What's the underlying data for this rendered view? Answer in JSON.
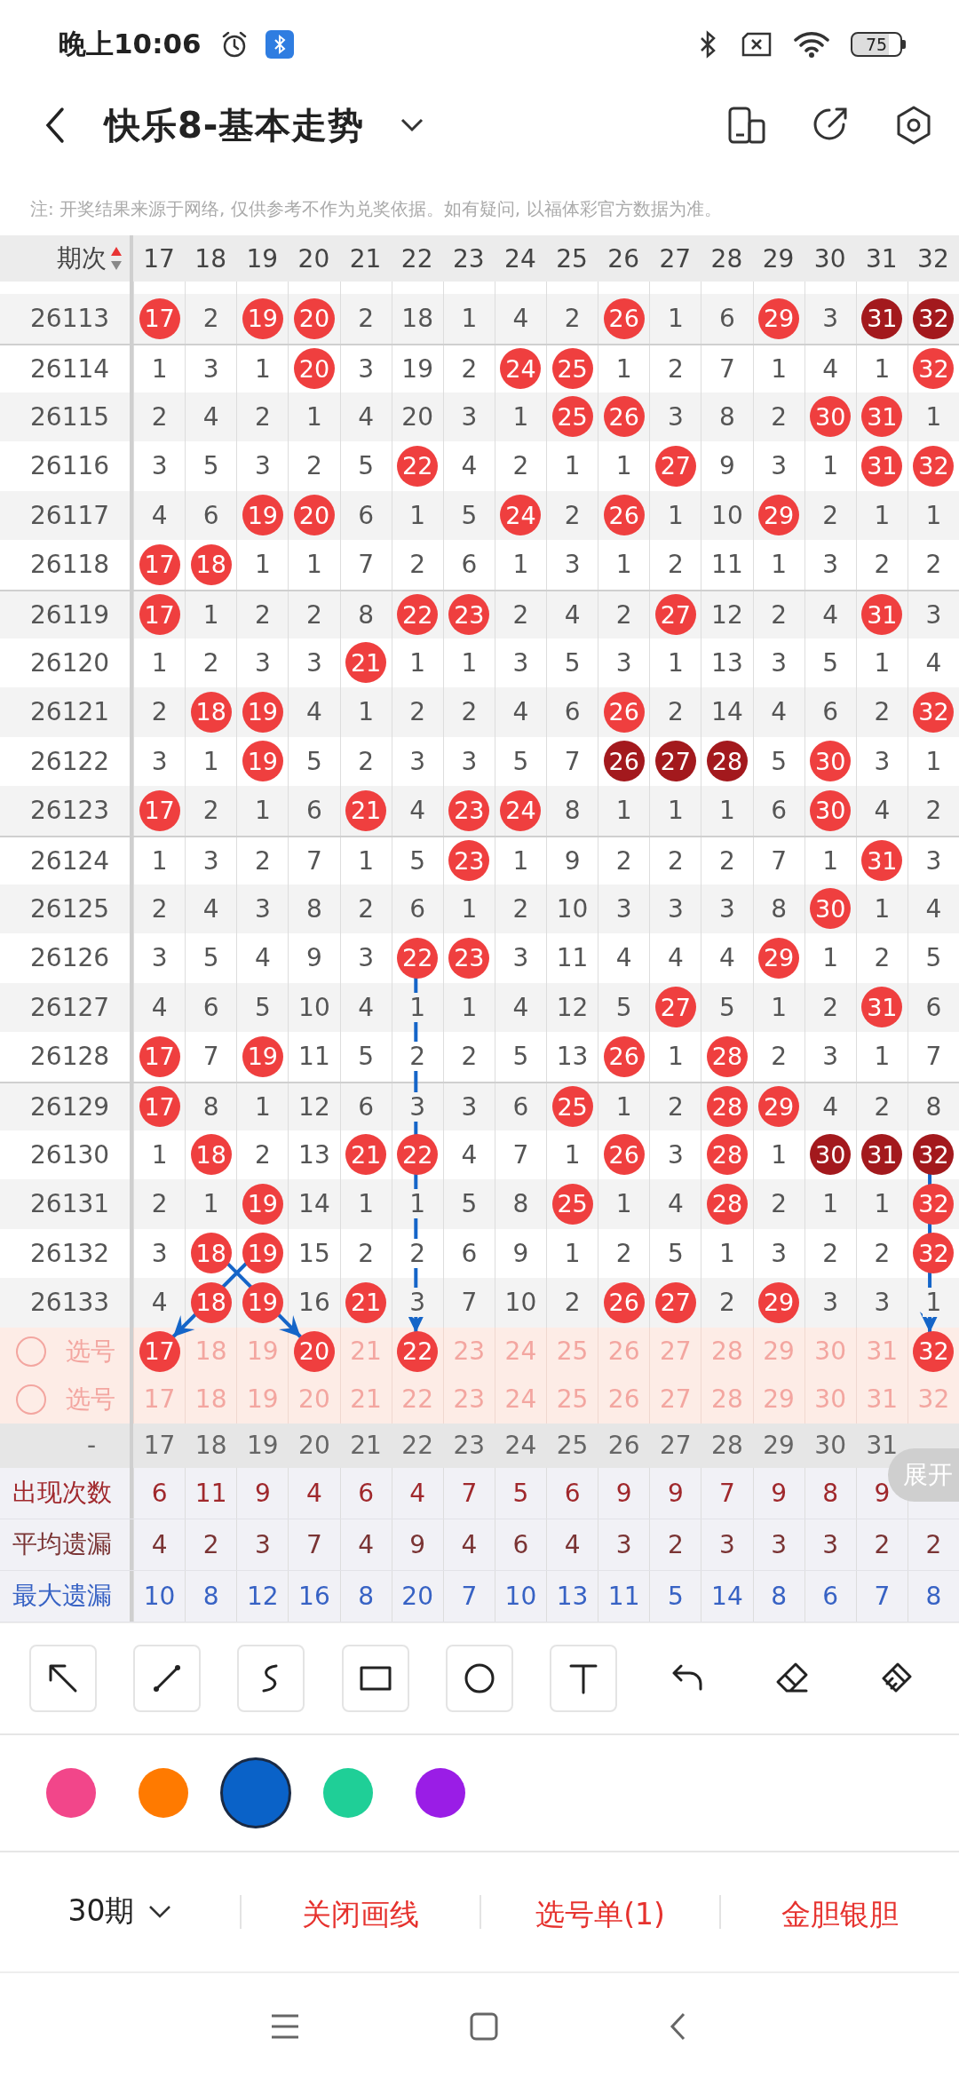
{
  "status_bar": {
    "time": "晚上10:06",
    "battery": "75"
  },
  "header": {
    "title": "快乐8-基本走势"
  },
  "notice": "注: 开奖结果来源于网络, 仅供参考不作为兑奖依据。如有疑问, 以福体彩官方数据为准。",
  "table": {
    "period_heading": "期次",
    "columns": [
      "17",
      "18",
      "19",
      "20",
      "21",
      "22",
      "23",
      "24",
      "25",
      "26",
      "27",
      "28",
      "29",
      "30",
      "31",
      "32"
    ],
    "rows": [
      {
        "period": "26113",
        "cells": [
          {
            "text": "17",
            "kind": "hit"
          },
          {
            "text": "2",
            "kind": "miss"
          },
          {
            "text": "19",
            "kind": "hit"
          },
          {
            "text": "20",
            "kind": "hit"
          },
          {
            "text": "2",
            "kind": "miss"
          },
          {
            "text": "18",
            "kind": "miss"
          },
          {
            "text": "1",
            "kind": "miss"
          },
          {
            "text": "4",
            "kind": "miss"
          },
          {
            "text": "2",
            "kind": "miss"
          },
          {
            "text": "26",
            "kind": "hit"
          },
          {
            "text": "1",
            "kind": "miss"
          },
          {
            "text": "6",
            "kind": "miss"
          },
          {
            "text": "29",
            "kind": "hit"
          },
          {
            "text": "3",
            "kind": "miss"
          },
          {
            "text": "31",
            "kind": "repeat"
          },
          {
            "text": "32",
            "kind": "repeat"
          }
        ]
      },
      {
        "period": "26114",
        "cells": [
          {
            "text": "1",
            "kind": "miss"
          },
          {
            "text": "3",
            "kind": "miss"
          },
          {
            "text": "1",
            "kind": "miss"
          },
          {
            "text": "20",
            "kind": "hit"
          },
          {
            "text": "3",
            "kind": "miss"
          },
          {
            "text": "19",
            "kind": "miss"
          },
          {
            "text": "2",
            "kind": "miss"
          },
          {
            "text": "24",
            "kind": "hit"
          },
          {
            "text": "25",
            "kind": "hit"
          },
          {
            "text": "1",
            "kind": "miss"
          },
          {
            "text": "2",
            "kind": "miss"
          },
          {
            "text": "7",
            "kind": "miss"
          },
          {
            "text": "1",
            "kind": "miss"
          },
          {
            "text": "4",
            "kind": "miss"
          },
          {
            "text": "1",
            "kind": "miss"
          },
          {
            "text": "32",
            "kind": "hit"
          }
        ]
      },
      {
        "period": "26115",
        "cells": [
          {
            "text": "2",
            "kind": "miss"
          },
          {
            "text": "4",
            "kind": "miss"
          },
          {
            "text": "2",
            "kind": "miss"
          },
          {
            "text": "1",
            "kind": "miss"
          },
          {
            "text": "4",
            "kind": "miss"
          },
          {
            "text": "20",
            "kind": "miss"
          },
          {
            "text": "3",
            "kind": "miss"
          },
          {
            "text": "1",
            "kind": "miss"
          },
          {
            "text": "25",
            "kind": "hit"
          },
          {
            "text": "26",
            "kind": "hit"
          },
          {
            "text": "3",
            "kind": "miss"
          },
          {
            "text": "8",
            "kind": "miss"
          },
          {
            "text": "2",
            "kind": "miss"
          },
          {
            "text": "30",
            "kind": "hit"
          },
          {
            "text": "31",
            "kind": "hit"
          },
          {
            "text": "1",
            "kind": "miss"
          }
        ]
      },
      {
        "period": "26116",
        "cells": [
          {
            "text": "3",
            "kind": "miss"
          },
          {
            "text": "5",
            "kind": "miss"
          },
          {
            "text": "3",
            "kind": "miss"
          },
          {
            "text": "2",
            "kind": "miss"
          },
          {
            "text": "5",
            "kind": "miss"
          },
          {
            "text": "22",
            "kind": "hit"
          },
          {
            "text": "4",
            "kind": "miss"
          },
          {
            "text": "2",
            "kind": "miss"
          },
          {
            "text": "1",
            "kind": "miss"
          },
          {
            "text": "1",
            "kind": "miss"
          },
          {
            "text": "27",
            "kind": "hit"
          },
          {
            "text": "9",
            "kind": "miss"
          },
          {
            "text": "3",
            "kind": "miss"
          },
          {
            "text": "1",
            "kind": "miss"
          },
          {
            "text": "31",
            "kind": "hit"
          },
          {
            "text": "32",
            "kind": "hit"
          }
        ]
      },
      {
        "period": "26117",
        "cells": [
          {
            "text": "4",
            "kind": "miss"
          },
          {
            "text": "6",
            "kind": "miss"
          },
          {
            "text": "19",
            "kind": "hit"
          },
          {
            "text": "20",
            "kind": "hit"
          },
          {
            "text": "6",
            "kind": "miss"
          },
          {
            "text": "1",
            "kind": "miss"
          },
          {
            "text": "5",
            "kind": "miss"
          },
          {
            "text": "24",
            "kind": "hit"
          },
          {
            "text": "2",
            "kind": "miss"
          },
          {
            "text": "26",
            "kind": "hit"
          },
          {
            "text": "1",
            "kind": "miss"
          },
          {
            "text": "10",
            "kind": "miss"
          },
          {
            "text": "29",
            "kind": "hit"
          },
          {
            "text": "2",
            "kind": "miss"
          },
          {
            "text": "1",
            "kind": "miss"
          },
          {
            "text": "1",
            "kind": "miss"
          }
        ]
      },
      {
        "period": "26118",
        "cells": [
          {
            "text": "17",
            "kind": "hit"
          },
          {
            "text": "18",
            "kind": "hit"
          },
          {
            "text": "1",
            "kind": "miss"
          },
          {
            "text": "1",
            "kind": "miss"
          },
          {
            "text": "7",
            "kind": "miss"
          },
          {
            "text": "2",
            "kind": "miss"
          },
          {
            "text": "6",
            "kind": "miss"
          },
          {
            "text": "1",
            "kind": "miss"
          },
          {
            "text": "3",
            "kind": "miss"
          },
          {
            "text": "1",
            "kind": "miss"
          },
          {
            "text": "2",
            "kind": "miss"
          },
          {
            "text": "11",
            "kind": "miss"
          },
          {
            "text": "1",
            "kind": "miss"
          },
          {
            "text": "3",
            "kind": "miss"
          },
          {
            "text": "2",
            "kind": "miss"
          },
          {
            "text": "2",
            "kind": "miss"
          }
        ]
      },
      {
        "period": "26119",
        "cells": [
          {
            "text": "17",
            "kind": "hit"
          },
          {
            "text": "1",
            "kind": "miss"
          },
          {
            "text": "2",
            "kind": "miss"
          },
          {
            "text": "2",
            "kind": "miss"
          },
          {
            "text": "8",
            "kind": "miss"
          },
          {
            "text": "22",
            "kind": "hit"
          },
          {
            "text": "23",
            "kind": "hit"
          },
          {
            "text": "2",
            "kind": "miss"
          },
          {
            "text": "4",
            "kind": "miss"
          },
          {
            "text": "2",
            "kind": "miss"
          },
          {
            "text": "27",
            "kind": "hit"
          },
          {
            "text": "12",
            "kind": "miss"
          },
          {
            "text": "2",
            "kind": "miss"
          },
          {
            "text": "4",
            "kind": "miss"
          },
          {
            "text": "31",
            "kind": "hit"
          },
          {
            "text": "3",
            "kind": "miss"
          }
        ]
      },
      {
        "period": "26120",
        "cells": [
          {
            "text": "1",
            "kind": "miss"
          },
          {
            "text": "2",
            "kind": "miss"
          },
          {
            "text": "3",
            "kind": "miss"
          },
          {
            "text": "3",
            "kind": "miss"
          },
          {
            "text": "21",
            "kind": "hit"
          },
          {
            "text": "1",
            "kind": "miss"
          },
          {
            "text": "1",
            "kind": "miss"
          },
          {
            "text": "3",
            "kind": "miss"
          },
          {
            "text": "5",
            "kind": "miss"
          },
          {
            "text": "3",
            "kind": "miss"
          },
          {
            "text": "1",
            "kind": "miss"
          },
          {
            "text": "13",
            "kind": "miss"
          },
          {
            "text": "3",
            "kind": "miss"
          },
          {
            "text": "5",
            "kind": "miss"
          },
          {
            "text": "1",
            "kind": "miss"
          },
          {
            "text": "4",
            "kind": "miss"
          }
        ]
      },
      {
        "period": "26121",
        "cells": [
          {
            "text": "2",
            "kind": "miss"
          },
          {
            "text": "18",
            "kind": "hit"
          },
          {
            "text": "19",
            "kind": "hit"
          },
          {
            "text": "4",
            "kind": "miss"
          },
          {
            "text": "1",
            "kind": "miss"
          },
          {
            "text": "2",
            "kind": "miss"
          },
          {
            "text": "2",
            "kind": "miss"
          },
          {
            "text": "4",
            "kind": "miss"
          },
          {
            "text": "6",
            "kind": "miss"
          },
          {
            "text": "26",
            "kind": "hit"
          },
          {
            "text": "2",
            "kind": "miss"
          },
          {
            "text": "14",
            "kind": "miss"
          },
          {
            "text": "4",
            "kind": "miss"
          },
          {
            "text": "6",
            "kind": "miss"
          },
          {
            "text": "2",
            "kind": "miss"
          },
          {
            "text": "32",
            "kind": "hit"
          }
        ]
      },
      {
        "period": "26122",
        "cells": [
          {
            "text": "3",
            "kind": "miss"
          },
          {
            "text": "1",
            "kind": "miss"
          },
          {
            "text": "19",
            "kind": "hit"
          },
          {
            "text": "5",
            "kind": "miss"
          },
          {
            "text": "2",
            "kind": "miss"
          },
          {
            "text": "3",
            "kind": "miss"
          },
          {
            "text": "3",
            "kind": "miss"
          },
          {
            "text": "5",
            "kind": "miss"
          },
          {
            "text": "7",
            "kind": "miss"
          },
          {
            "text": "26",
            "kind": "repeat"
          },
          {
            "text": "27",
            "kind": "repeat"
          },
          {
            "text": "28",
            "kind": "repeat"
          },
          {
            "text": "5",
            "kind": "miss"
          },
          {
            "text": "30",
            "kind": "hit"
          },
          {
            "text": "3",
            "kind": "miss"
          },
          {
            "text": "1",
            "kind": "miss"
          }
        ]
      },
      {
        "period": "26123",
        "cells": [
          {
            "text": "17",
            "kind": "hit"
          },
          {
            "text": "2",
            "kind": "miss"
          },
          {
            "text": "1",
            "kind": "miss"
          },
          {
            "text": "6",
            "kind": "miss"
          },
          {
            "text": "21",
            "kind": "hit"
          },
          {
            "text": "4",
            "kind": "miss"
          },
          {
            "text": "23",
            "kind": "hit"
          },
          {
            "text": "24",
            "kind": "hit"
          },
          {
            "text": "8",
            "kind": "miss"
          },
          {
            "text": "1",
            "kind": "miss"
          },
          {
            "text": "1",
            "kind": "miss"
          },
          {
            "text": "1",
            "kind": "miss"
          },
          {
            "text": "6",
            "kind": "miss"
          },
          {
            "text": "30",
            "kind": "hit"
          },
          {
            "text": "4",
            "kind": "miss"
          },
          {
            "text": "2",
            "kind": "miss"
          }
        ]
      },
      {
        "period": "26124",
        "cells": [
          {
            "text": "1",
            "kind": "miss"
          },
          {
            "text": "3",
            "kind": "miss"
          },
          {
            "text": "2",
            "kind": "miss"
          },
          {
            "text": "7",
            "kind": "miss"
          },
          {
            "text": "1",
            "kind": "miss"
          },
          {
            "text": "5",
            "kind": "miss"
          },
          {
            "text": "23",
            "kind": "hit"
          },
          {
            "text": "1",
            "kind": "miss"
          },
          {
            "text": "9",
            "kind": "miss"
          },
          {
            "text": "2",
            "kind": "miss"
          },
          {
            "text": "2",
            "kind": "miss"
          },
          {
            "text": "2",
            "kind": "miss"
          },
          {
            "text": "7",
            "kind": "miss"
          },
          {
            "text": "1",
            "kind": "miss"
          },
          {
            "text": "31",
            "kind": "hit"
          },
          {
            "text": "3",
            "kind": "miss"
          }
        ]
      },
      {
        "period": "26125",
        "cells": [
          {
            "text": "2",
            "kind": "miss"
          },
          {
            "text": "4",
            "kind": "miss"
          },
          {
            "text": "3",
            "kind": "miss"
          },
          {
            "text": "8",
            "kind": "miss"
          },
          {
            "text": "2",
            "kind": "miss"
          },
          {
            "text": "6",
            "kind": "miss"
          },
          {
            "text": "1",
            "kind": "miss"
          },
          {
            "text": "2",
            "kind": "miss"
          },
          {
            "text": "10",
            "kind": "miss"
          },
          {
            "text": "3",
            "kind": "miss"
          },
          {
            "text": "3",
            "kind": "miss"
          },
          {
            "text": "3",
            "kind": "miss"
          },
          {
            "text": "8",
            "kind": "miss"
          },
          {
            "text": "30",
            "kind": "hit"
          },
          {
            "text": "1",
            "kind": "miss"
          },
          {
            "text": "4",
            "kind": "miss"
          }
        ]
      },
      {
        "period": "26126",
        "cells": [
          {
            "text": "3",
            "kind": "miss"
          },
          {
            "text": "5",
            "kind": "miss"
          },
          {
            "text": "4",
            "kind": "miss"
          },
          {
            "text": "9",
            "kind": "miss"
          },
          {
            "text": "3",
            "kind": "miss"
          },
          {
            "text": "22",
            "kind": "hit"
          },
          {
            "text": "23",
            "kind": "hit"
          },
          {
            "text": "3",
            "kind": "miss"
          },
          {
            "text": "11",
            "kind": "miss"
          },
          {
            "text": "4",
            "kind": "miss"
          },
          {
            "text": "4",
            "kind": "miss"
          },
          {
            "text": "4",
            "kind": "miss"
          },
          {
            "text": "29",
            "kind": "hit"
          },
          {
            "text": "1",
            "kind": "miss"
          },
          {
            "text": "2",
            "kind": "miss"
          },
          {
            "text": "5",
            "kind": "miss"
          }
        ]
      },
      {
        "period": "26127",
        "cells": [
          {
            "text": "4",
            "kind": "miss"
          },
          {
            "text": "6",
            "kind": "miss"
          },
          {
            "text": "5",
            "kind": "miss"
          },
          {
            "text": "10",
            "kind": "miss"
          },
          {
            "text": "4",
            "kind": "miss"
          },
          {
            "text": "1",
            "kind": "miss"
          },
          {
            "text": "1",
            "kind": "miss"
          },
          {
            "text": "4",
            "kind": "miss"
          },
          {
            "text": "12",
            "kind": "miss"
          },
          {
            "text": "5",
            "kind": "miss"
          },
          {
            "text": "27",
            "kind": "hit"
          },
          {
            "text": "5",
            "kind": "miss"
          },
          {
            "text": "1",
            "kind": "miss"
          },
          {
            "text": "2",
            "kind": "miss"
          },
          {
            "text": "31",
            "kind": "hit"
          },
          {
            "text": "6",
            "kind": "miss"
          }
        ]
      },
      {
        "period": "26128",
        "cells": [
          {
            "text": "17",
            "kind": "hit"
          },
          {
            "text": "7",
            "kind": "miss"
          },
          {
            "text": "19",
            "kind": "hit"
          },
          {
            "text": "11",
            "kind": "miss"
          },
          {
            "text": "5",
            "kind": "miss"
          },
          {
            "text": "2",
            "kind": "miss"
          },
          {
            "text": "2",
            "kind": "miss"
          },
          {
            "text": "5",
            "kind": "miss"
          },
          {
            "text": "13",
            "kind": "miss"
          },
          {
            "text": "26",
            "kind": "hit"
          },
          {
            "text": "1",
            "kind": "miss"
          },
          {
            "text": "28",
            "kind": "hit"
          },
          {
            "text": "2",
            "kind": "miss"
          },
          {
            "text": "3",
            "kind": "miss"
          },
          {
            "text": "1",
            "kind": "miss"
          },
          {
            "text": "7",
            "kind": "miss"
          }
        ]
      },
      {
        "period": "26129",
        "cells": [
          {
            "text": "17",
            "kind": "hit"
          },
          {
            "text": "8",
            "kind": "miss"
          },
          {
            "text": "1",
            "kind": "miss"
          },
          {
            "text": "12",
            "kind": "miss"
          },
          {
            "text": "6",
            "kind": "miss"
          },
          {
            "text": "3",
            "kind": "miss"
          },
          {
            "text": "3",
            "kind": "miss"
          },
          {
            "text": "6",
            "kind": "miss"
          },
          {
            "text": "25",
            "kind": "hit"
          },
          {
            "text": "1",
            "kind": "miss"
          },
          {
            "text": "2",
            "kind": "miss"
          },
          {
            "text": "28",
            "kind": "hit"
          },
          {
            "text": "29",
            "kind": "hit"
          },
          {
            "text": "4",
            "kind": "miss"
          },
          {
            "text": "2",
            "kind": "miss"
          },
          {
            "text": "8",
            "kind": "miss"
          }
        ]
      },
      {
        "period": "26130",
        "cells": [
          {
            "text": "1",
            "kind": "miss"
          },
          {
            "text": "18",
            "kind": "hit"
          },
          {
            "text": "2",
            "kind": "miss"
          },
          {
            "text": "13",
            "kind": "miss"
          },
          {
            "text": "21",
            "kind": "hit"
          },
          {
            "text": "22",
            "kind": "hit"
          },
          {
            "text": "4",
            "kind": "miss"
          },
          {
            "text": "7",
            "kind": "miss"
          },
          {
            "text": "1",
            "kind": "miss"
          },
          {
            "text": "26",
            "kind": "hit"
          },
          {
            "text": "3",
            "kind": "miss"
          },
          {
            "text": "28",
            "kind": "hit"
          },
          {
            "text": "1",
            "kind": "miss"
          },
          {
            "text": "30",
            "kind": "repeat"
          },
          {
            "text": "31",
            "kind": "repeat"
          },
          {
            "text": "32",
            "kind": "repeat"
          }
        ]
      },
      {
        "period": "26131",
        "cells": [
          {
            "text": "2",
            "kind": "miss"
          },
          {
            "text": "1",
            "kind": "miss"
          },
          {
            "text": "19",
            "kind": "hit"
          },
          {
            "text": "14",
            "kind": "miss"
          },
          {
            "text": "1",
            "kind": "miss"
          },
          {
            "text": "1",
            "kind": "miss"
          },
          {
            "text": "5",
            "kind": "miss"
          },
          {
            "text": "8",
            "kind": "miss"
          },
          {
            "text": "25",
            "kind": "hit"
          },
          {
            "text": "1",
            "kind": "miss"
          },
          {
            "text": "4",
            "kind": "miss"
          },
          {
            "text": "28",
            "kind": "hit"
          },
          {
            "text": "2",
            "kind": "miss"
          },
          {
            "text": "1",
            "kind": "miss"
          },
          {
            "text": "1",
            "kind": "miss"
          },
          {
            "text": "32",
            "kind": "hit"
          }
        ]
      },
      {
        "period": "26132",
        "cells": [
          {
            "text": "3",
            "kind": "miss"
          },
          {
            "text": "18",
            "kind": "hit"
          },
          {
            "text": "19",
            "kind": "hit"
          },
          {
            "text": "15",
            "kind": "miss"
          },
          {
            "text": "2",
            "kind": "miss"
          },
          {
            "text": "2",
            "kind": "miss"
          },
          {
            "text": "6",
            "kind": "miss"
          },
          {
            "text": "9",
            "kind": "miss"
          },
          {
            "text": "1",
            "kind": "miss"
          },
          {
            "text": "2",
            "kind": "miss"
          },
          {
            "text": "5",
            "kind": "miss"
          },
          {
            "text": "1",
            "kind": "miss"
          },
          {
            "text": "3",
            "kind": "miss"
          },
          {
            "text": "2",
            "kind": "miss"
          },
          {
            "text": "2",
            "kind": "miss"
          },
          {
            "text": "32",
            "kind": "hit"
          }
        ]
      },
      {
        "period": "26133",
        "cells": [
          {
            "text": "4",
            "kind": "miss"
          },
          {
            "text": "18",
            "kind": "hit"
          },
          {
            "text": "19",
            "kind": "hit"
          },
          {
            "text": "16",
            "kind": "miss"
          },
          {
            "text": "21",
            "kind": "hit"
          },
          {
            "text": "3",
            "kind": "miss"
          },
          {
            "text": "7",
            "kind": "miss"
          },
          {
            "text": "10",
            "kind": "miss"
          },
          {
            "text": "2",
            "kind": "miss"
          },
          {
            "text": "26",
            "kind": "hit"
          },
          {
            "text": "27",
            "kind": "hit"
          },
          {
            "text": "2",
            "kind": "miss"
          },
          {
            "text": "29",
            "kind": "hit"
          },
          {
            "text": "3",
            "kind": "miss"
          },
          {
            "text": "3",
            "kind": "miss"
          },
          {
            "text": "1",
            "kind": "miss"
          }
        ]
      }
    ]
  },
  "pick_rows": [
    {
      "label": "选号",
      "checked": false,
      "cells": [
        {
          "text": "17",
          "selected": true
        },
        {
          "text": "18",
          "selected": false
        },
        {
          "text": "19",
          "selected": false
        },
        {
          "text": "20",
          "selected": true
        },
        {
          "text": "21",
          "selected": false
        },
        {
          "text": "22",
          "selected": true
        },
        {
          "text": "23",
          "selected": false
        },
        {
          "text": "24",
          "selected": false
        },
        {
          "text": "25",
          "selected": false
        },
        {
          "text": "26",
          "selected": false
        },
        {
          "text": "27",
          "selected": false
        },
        {
          "text": "28",
          "selected": false
        },
        {
          "text": "29",
          "selected": false
        },
        {
          "text": "30",
          "selected": false
        },
        {
          "text": "31",
          "selected": false
        },
        {
          "text": "32",
          "selected": true
        }
      ]
    },
    {
      "label": "选号",
      "checked": false,
      "cells": [
        {
          "text": "17",
          "selected": false
        },
        {
          "text": "18",
          "selected": false
        },
        {
          "text": "19",
          "selected": false
        },
        {
          "text": "20",
          "selected": false
        },
        {
          "text": "21",
          "selected": false
        },
        {
          "text": "22",
          "selected": false
        },
        {
          "text": "23",
          "selected": false
        },
        {
          "text": "24",
          "selected": false
        },
        {
          "text": "25",
          "selected": false
        },
        {
          "text": "26",
          "selected": false
        },
        {
          "text": "27",
          "selected": false
        },
        {
          "text": "28",
          "selected": false
        },
        {
          "text": "29",
          "selected": false
        },
        {
          "text": "30",
          "selected": false
        },
        {
          "text": "31",
          "selected": false
        },
        {
          "text": "32",
          "selected": false
        }
      ]
    }
  ],
  "summary": {
    "heading": "-",
    "columns": [
      "17",
      "18",
      "19",
      "20",
      "21",
      "22",
      "23",
      "24",
      "25",
      "26",
      "27",
      "28",
      "29",
      "30",
      "31"
    ],
    "stats": [
      {
        "label": "出现次数",
        "kind": "count",
        "values": [
          "6",
          "11",
          "9",
          "4",
          "6",
          "4",
          "7",
          "5",
          "6",
          "9",
          "9",
          "7",
          "9",
          "8",
          "9"
        ]
      },
      {
        "label": "平均遗漏",
        "kind": "average",
        "values": [
          "4",
          "2",
          "3",
          "7",
          "4",
          "9",
          "4",
          "6",
          "4",
          "3",
          "2",
          "3",
          "3",
          "3",
          "2",
          "2"
        ]
      },
      {
        "label": "最大遗漏",
        "kind": "max",
        "values": [
          "10",
          "8",
          "12",
          "16",
          "8",
          "20",
          "7",
          "10",
          "13",
          "11",
          "5",
          "14",
          "8",
          "6",
          "7",
          "8"
        ]
      }
    ]
  },
  "expand_button": "展开",
  "palette": [
    {
      "color": "#f2468a",
      "selected": false
    },
    {
      "color": "#ff7a00",
      "selected": false
    },
    {
      "color": "#0a62c8",
      "selected": true
    },
    {
      "color": "#1fcf97",
      "selected": false
    },
    {
      "color": "#9a1de6",
      "selected": false
    }
  ],
  "bottom_bar": {
    "period_select": "30期",
    "actions": [
      "关闭画线",
      "选号单(1)",
      "金胆银胆"
    ]
  }
}
